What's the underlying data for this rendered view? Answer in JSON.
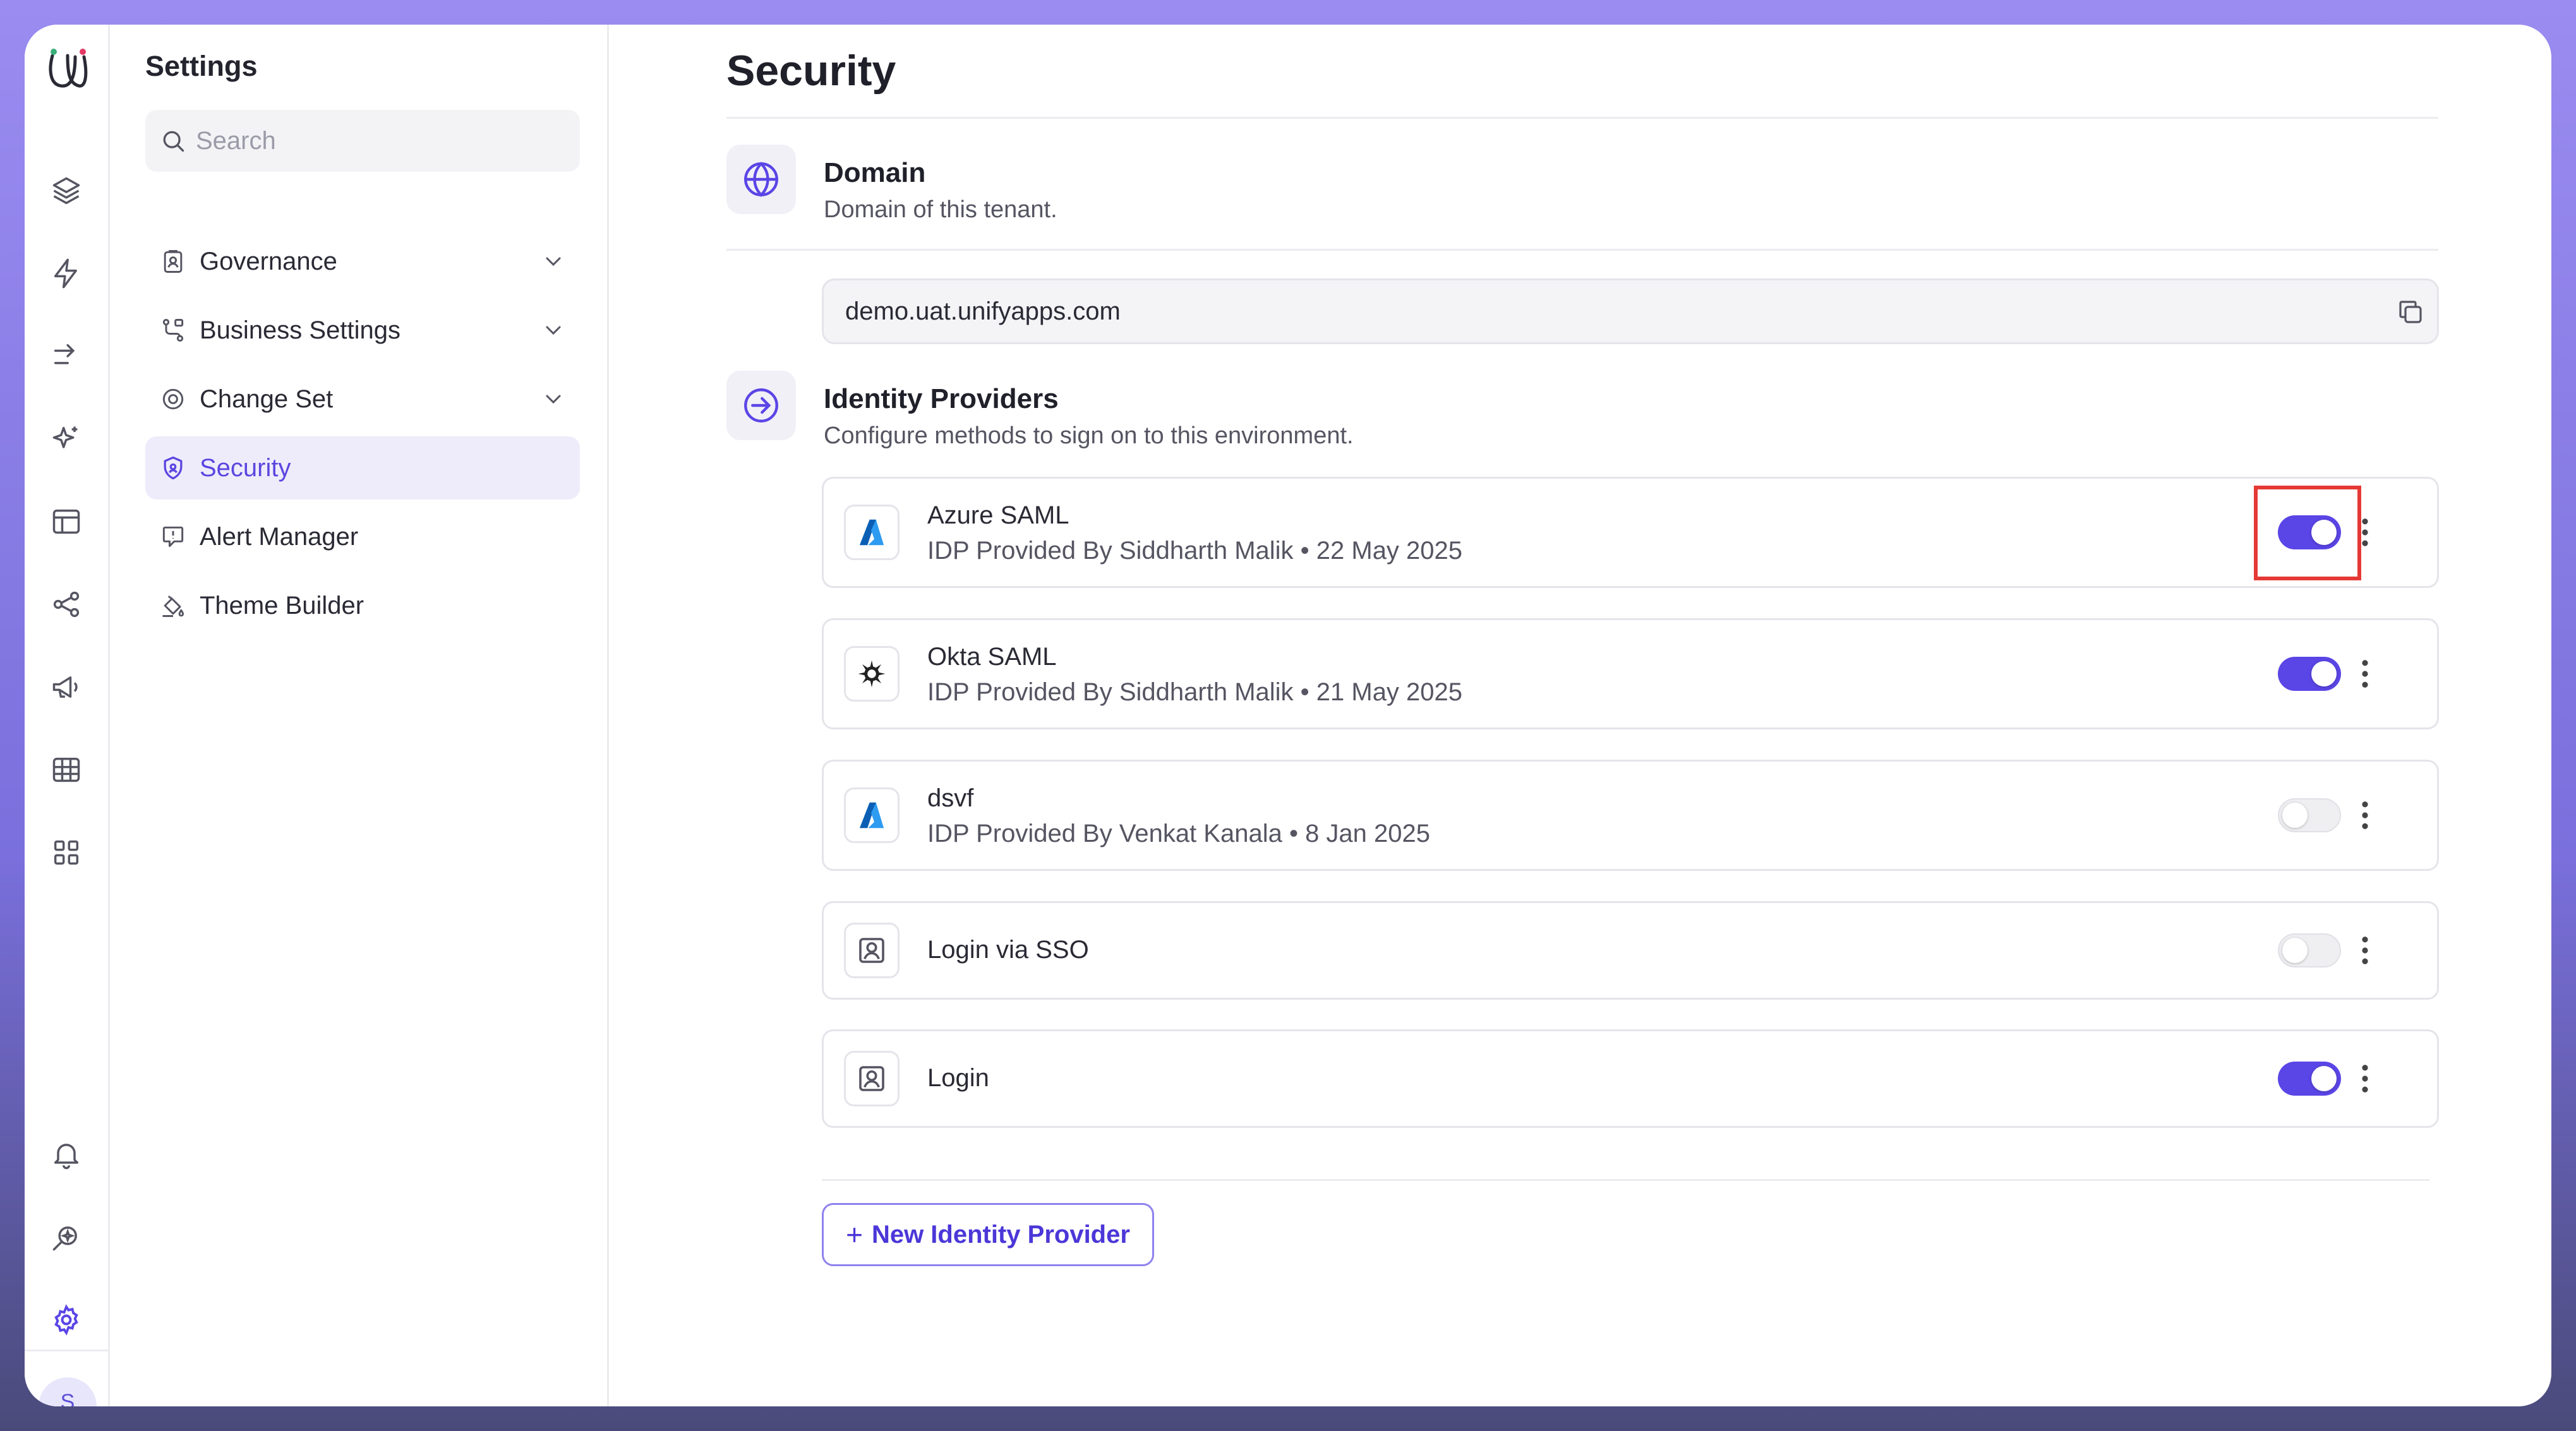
{
  "settings": {
    "title": "Settings",
    "search_placeholder": "Search",
    "nav": [
      {
        "label": "Governance",
        "icon": "clipboard-user-icon",
        "expandable": true
      },
      {
        "label": "Business Settings",
        "icon": "workflow-icon",
        "expandable": true
      },
      {
        "label": "Change Set",
        "icon": "target-icon",
        "expandable": true
      },
      {
        "label": "Security",
        "icon": "shield-icon",
        "expandable": false,
        "active": true
      },
      {
        "label": "Alert Manager",
        "icon": "alert-message-icon",
        "expandable": false
      },
      {
        "label": "Theme Builder",
        "icon": "paint-bucket-icon",
        "expandable": false
      }
    ]
  },
  "rail": {
    "icons": [
      "layers-icon",
      "bolt-icon",
      "arrow-right-icon",
      "sparkles-icon",
      "layout-icon",
      "share-nodes-icon",
      "megaphone-icon",
      "table-icon",
      "grid-icon",
      "bell-icon",
      "search-sparkle-icon",
      "gear-icon"
    ],
    "avatar_initial": "S"
  },
  "main": {
    "page_title": "Security",
    "domain": {
      "title": "Domain",
      "subtitle": "Domain of this tenant.",
      "value": "demo.uat.unifyapps.com"
    },
    "identity_providers": {
      "title": "Identity Providers",
      "subtitle": "Configure methods to sign on to this environment.",
      "items": [
        {
          "name": "Azure SAML",
          "meta": "IDP Provided By Siddharth Malik • 22 May 2025",
          "logo": "azure-icon",
          "enabled": true
        },
        {
          "name": "Okta SAML",
          "meta": "IDP Provided By Siddharth Malik • 21 May 2025",
          "logo": "okta-icon",
          "enabled": true
        },
        {
          "name": "dsvf",
          "meta": "IDP Provided By Venkat Kanala • 8 Jan 2025",
          "logo": "azure-icon",
          "enabled": false
        },
        {
          "name": "Login via SSO",
          "meta": "",
          "logo": "user-portrait-icon",
          "enabled": false
        },
        {
          "name": "Login",
          "meta": "",
          "logo": "user-portrait-icon",
          "enabled": true
        }
      ],
      "new_button_label": "New Identity Provider"
    }
  },
  "colors": {
    "accent": "#5a45e6",
    "highlight": "#e53935"
  }
}
